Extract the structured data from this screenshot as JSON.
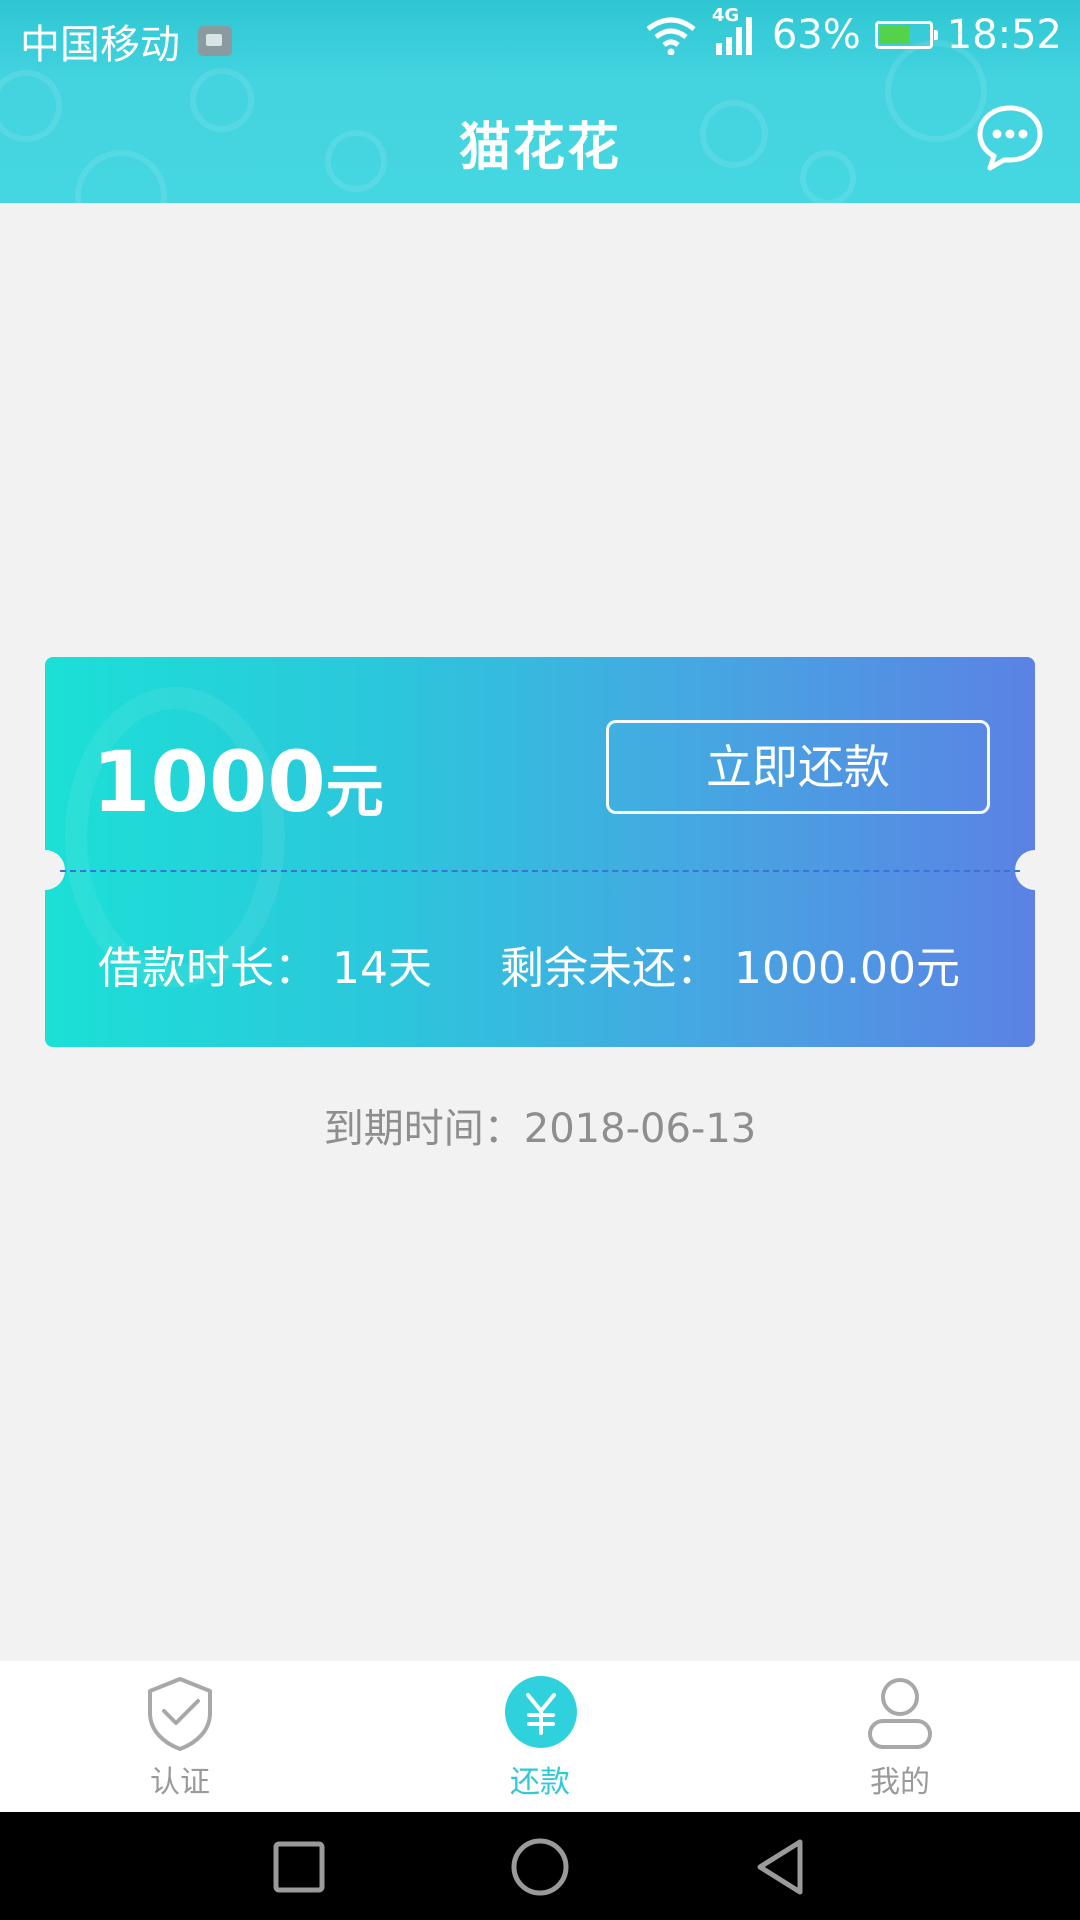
{
  "status_bar": {
    "carrier": "中国移动",
    "network": "4G",
    "battery_percent": "63%",
    "battery_level": 0.63,
    "time": "18:52"
  },
  "header": {
    "title": "猫花花",
    "message_icon": "chat-bubble-icon"
  },
  "loan_card": {
    "amount": "1000",
    "amount_unit": "元",
    "repay_button": "立即还款",
    "duration_label": "借款时长：",
    "duration_value": "14天",
    "remaining_label": "剩余未还：",
    "remaining_value": "1000.00元"
  },
  "due": {
    "label": "到期时间：",
    "date": "2018-06-13"
  },
  "tabbar": {
    "items": [
      {
        "label": "认证",
        "icon": "shield-check-icon",
        "active": false
      },
      {
        "label": "还款",
        "icon": "yuan-icon",
        "active": true
      },
      {
        "label": "我的",
        "icon": "person-icon",
        "active": false
      }
    ]
  },
  "colors": {
    "header": "#44d6e1",
    "card_start": "#1be0d6",
    "card_end": "#5b82e4",
    "tab_active": "#2fc9d8",
    "tab_inactive": "#9a9a9a"
  },
  "nav_bar": {
    "buttons": [
      "recent-apps-icon",
      "home-icon",
      "back-icon"
    ]
  }
}
